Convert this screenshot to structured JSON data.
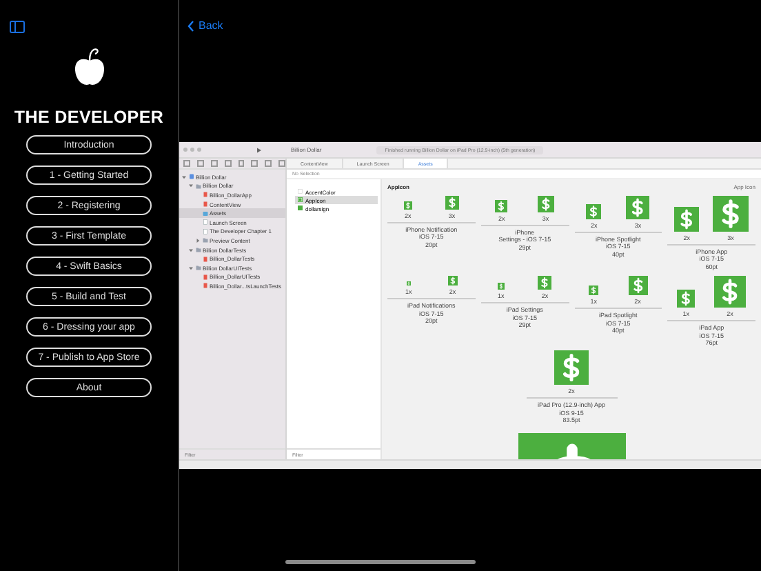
{
  "sidebar": {
    "title": "THE DEVELOPER",
    "items": [
      {
        "label": "Introduction"
      },
      {
        "label": "1 - Getting Started"
      },
      {
        "label": "2 - Registering"
      },
      {
        "label": "3 - First Template"
      },
      {
        "label": "4 - Swift Basics"
      },
      {
        "label": "5 - Build and Test"
      },
      {
        "label": "6 - Dressing your app"
      },
      {
        "label": "7 - Publish to App Store"
      },
      {
        "label": "About"
      }
    ]
  },
  "nav": {
    "back": "Back"
  },
  "screenshot": {
    "window_title": "Billion Dollar",
    "status": "Finished running Billion Dollar on iPad Pro (12.9-inch) (5th generation)",
    "tabs": [
      {
        "label": "ContentView",
        "selected": false
      },
      {
        "label": "Launch Screen",
        "selected": false
      },
      {
        "label": "Assets",
        "selected": true
      }
    ],
    "jump_bar": "No Selection",
    "tree": [
      {
        "label": "Billion Dollar",
        "kind": "project",
        "selected": false,
        "expanded": true,
        "children": [
          {
            "label": "Billion Dollar",
            "kind": "folder",
            "selected": false,
            "expanded": true,
            "children": [
              {
                "label": "Billion_DollarApp",
                "kind": "swift",
                "selected": false
              },
              {
                "label": "ContentView",
                "kind": "swift",
                "selected": false
              },
              {
                "label": "Assets",
                "kind": "assets",
                "selected": true
              },
              {
                "label": "Launch Screen",
                "kind": "file",
                "selected": false
              },
              {
                "label": "The Developer Chapter 1",
                "kind": "file",
                "selected": false
              },
              {
                "label": "Preview Content",
                "kind": "folder",
                "selected": false,
                "expanded": false
              }
            ]
          },
          {
            "label": "Billion DollarTests",
            "kind": "folder",
            "selected": false,
            "expanded": true,
            "children": [
              {
                "label": "Billion_DollarTests",
                "kind": "swift",
                "selected": false
              }
            ]
          },
          {
            "label": "Billion DollarUITests",
            "kind": "folder",
            "selected": false,
            "expanded": true,
            "children": [
              {
                "label": "Billion_DollarUITests",
                "kind": "swift",
                "selected": false
              },
              {
                "label": "Billion_Dollar...tsLaunchTests",
                "kind": "swift",
                "selected": false
              }
            ]
          }
        ]
      }
    ],
    "nav_filter_placeholder": "Filter",
    "assets": [
      {
        "label": "AccentColor",
        "kind": "color",
        "selected": false
      },
      {
        "label": "AppIcon",
        "kind": "appicon",
        "selected": true
      },
      {
        "label": "dollarsign",
        "kind": "image",
        "selected": false
      }
    ],
    "asset_filter_placeholder": "Filter",
    "canvas": {
      "title": "AppIcon",
      "side_label": "App Icon",
      "rows": [
        {
          "groups": [
            {
              "scales": [
                "2x",
                "3x"
              ],
              "caption": [
                "iPhone Notification",
                "iOS 7-15",
                "20pt"
              ]
            },
            {
              "scales": [
                "2x",
                "3x"
              ],
              "caption": [
                "iPhone",
                "Settings - iOS 7-15",
                "29pt"
              ]
            },
            {
              "scales": [
                "2x",
                "3x"
              ],
              "caption": [
                "iPhone Spotlight",
                "iOS 7-15",
                "40pt"
              ]
            },
            {
              "scales": [
                "2x",
                "3x"
              ],
              "caption": [
                "iPhone App",
                "iOS 7-15",
                "60pt"
              ]
            }
          ]
        },
        {
          "groups": [
            {
              "scales": [
                "1x",
                "2x"
              ],
              "caption": [
                "iPad Notifications",
                "iOS 7-15",
                "20pt"
              ]
            },
            {
              "scales": [
                "1x",
                "2x"
              ],
              "caption": [
                "iPad Settings",
                "iOS 7-15",
                "29pt"
              ]
            },
            {
              "scales": [
                "1x",
                "2x"
              ],
              "caption": [
                "iPad Spotlight",
                "iOS 7-15",
                "40pt"
              ]
            },
            {
              "scales": [
                "1x",
                "2x"
              ],
              "caption": [
                "iPad App",
                "iOS 7-15",
                "76pt"
              ]
            }
          ]
        },
        {
          "groups": [
            {
              "scales": [
                "2x"
              ],
              "caption": [
                "iPad Pro (12.9-inch) App",
                "iOS 9-15",
                "83.5pt"
              ]
            }
          ]
        }
      ]
    }
  }
}
